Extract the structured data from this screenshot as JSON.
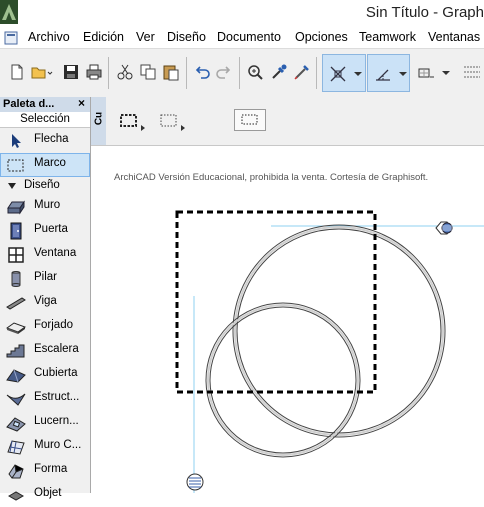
{
  "window": {
    "title": "Sin Título - Graph"
  },
  "menu": {
    "items": [
      "Archivo",
      "Edición",
      "Ver",
      "Diseño",
      "Documento",
      "Opciones",
      "Teamwork",
      "Ventanas"
    ]
  },
  "palette": {
    "title": "Paleta d...",
    "close": "×",
    "section_selection": "Selección",
    "section_design": "Diseño",
    "tools": [
      {
        "label": "Flecha",
        "icon": "arrow-pointer-icon"
      },
      {
        "label": "Marco",
        "icon": "marquee-icon"
      },
      {
        "label": "Muro",
        "icon": "wall-icon"
      },
      {
        "label": "Puerta",
        "icon": "door-icon"
      },
      {
        "label": "Ventana",
        "icon": "window-icon"
      },
      {
        "label": "Pilar",
        "icon": "column-icon"
      },
      {
        "label": "Viga",
        "icon": "beam-icon"
      },
      {
        "label": "Forjado",
        "icon": "slab-icon"
      },
      {
        "label": "Escalera",
        "icon": "stair-icon"
      },
      {
        "label": "Cubierta",
        "icon": "roof-icon"
      },
      {
        "label": "Estruct...",
        "icon": "shell-icon"
      },
      {
        "label": "Lucern...",
        "icon": "skylight-icon"
      },
      {
        "label": "Muro C...",
        "icon": "curtain-wall-icon"
      },
      {
        "label": "Forma",
        "icon": "morph-icon"
      },
      {
        "label": "Objet",
        "icon": "object-icon"
      }
    ]
  },
  "infobox": {
    "tab_label": "Cu"
  },
  "canvas": {
    "watermark": "ArchiCAD Versión Educacional, prohibida la venta. Cortesía de Graphisoft."
  },
  "colors": {
    "accent": "#cde4f7",
    "selection_border": "#7eb4ea",
    "guide_line": "#8fd0f0"
  }
}
